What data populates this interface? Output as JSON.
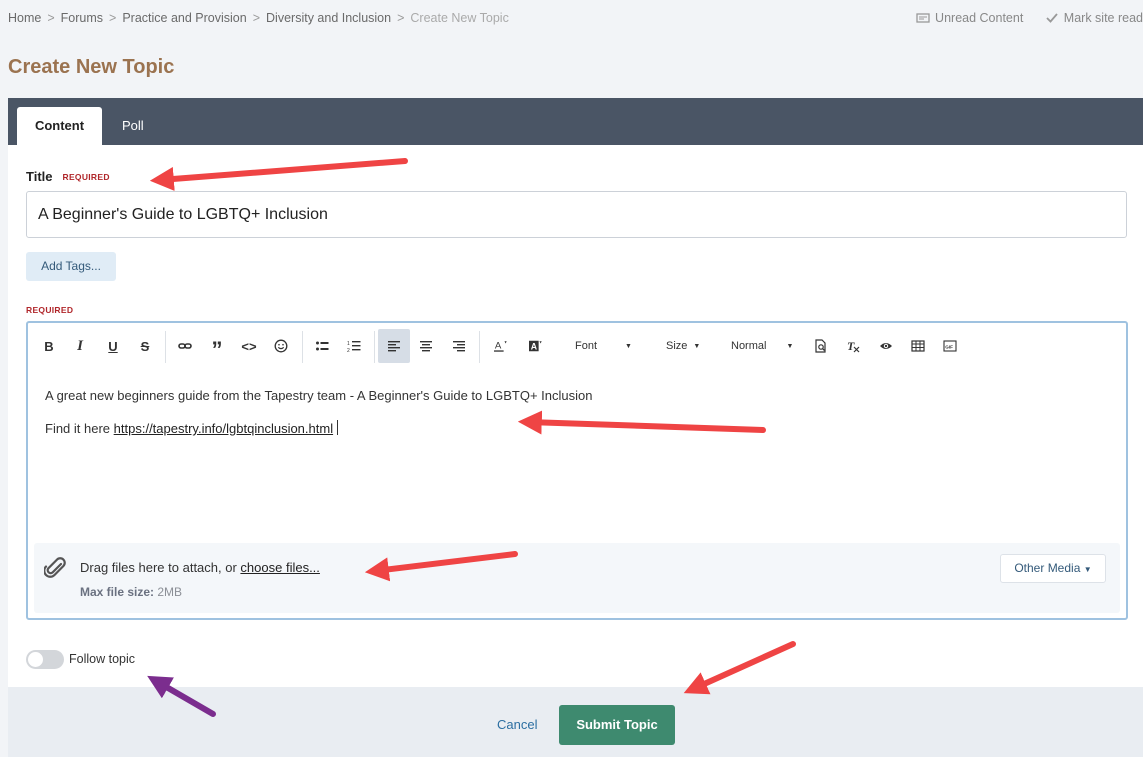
{
  "breadcrumb": {
    "items": [
      "Home",
      "Forums",
      "Practice and Provision",
      "Diversity and Inclusion"
    ],
    "current": "Create New Topic"
  },
  "quick_links": {
    "unread": "Unread Content",
    "mark_read": "Mark site read"
  },
  "page_title": "Create New Topic",
  "tabs": [
    {
      "label": "Content",
      "active": true
    },
    {
      "label": "Poll",
      "active": false
    }
  ],
  "form": {
    "title_label": "Title",
    "required_label": "REQUIRED",
    "title_value": "A Beginner's Guide to LGBTQ+ Inclusion",
    "add_tags_label": "Add Tags...",
    "editor_required_label": "REQUIRED"
  },
  "editor": {
    "toolbar": {
      "bold": "B",
      "italic": "I",
      "underline": "U",
      "strike": "S",
      "quote": "”",
      "code": "<>",
      "font": "Font",
      "size": "Size",
      "format": "Normal"
    },
    "line1": "A great new beginners guide from the Tapestry team - A Beginner's Guide to LGBTQ+ Inclusion",
    "line2_prefix": "Find it here ",
    "link": "https://tapestry.info/lgbtqinclusion.html"
  },
  "attach": {
    "drag_text": "Drag files here to attach, or ",
    "choose_link": "choose files...",
    "max_label": "Max file size:",
    "max_value": "2MB",
    "other_media": "Other Media"
  },
  "follow": {
    "label": "Follow topic",
    "on": false
  },
  "actions": {
    "cancel": "Cancel",
    "submit": "Submit Topic"
  },
  "colors": {
    "title": "#9b7350",
    "tabbar": "#4a5565",
    "submit": "#3e8a6f",
    "required": "#b0262a",
    "arrow_red": "#ef4444",
    "arrow_purple": "#7b2d8e"
  }
}
